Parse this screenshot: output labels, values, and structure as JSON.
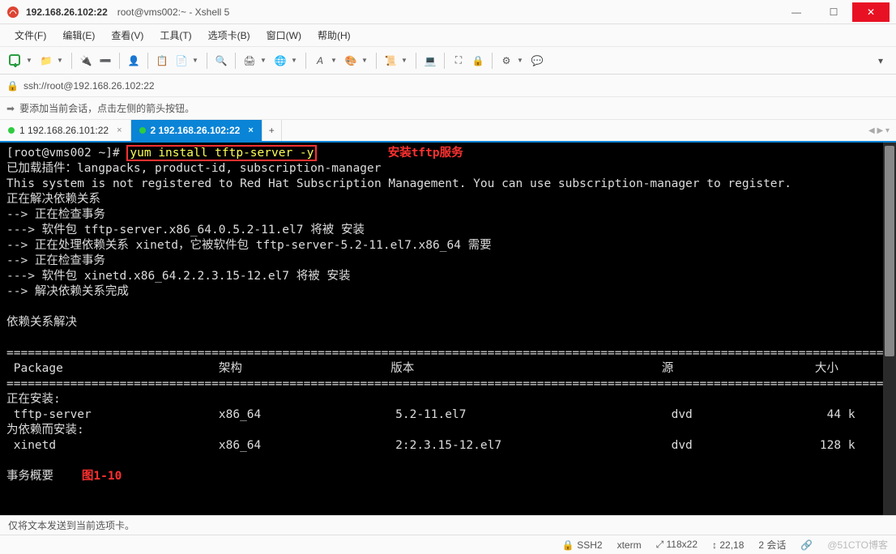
{
  "titlebar": {
    "address": "192.168.26.102:22",
    "title": "root@vms002:~ - Xshell 5"
  },
  "menu": {
    "file": "文件(F)",
    "edit": "编辑(E)",
    "view": "查看(V)",
    "tools": "工具(T)",
    "tabs": "选项卡(B)",
    "window": "窗口(W)",
    "help": "帮助(H)"
  },
  "addressbar": {
    "url": "ssh://root@192.168.26.102:22"
  },
  "infobar": {
    "text": "要添加当前会话，点击左侧的箭头按钮。"
  },
  "tabs": {
    "t1": "1 192.168.26.101:22",
    "t2": "2 192.168.26.102:22",
    "new": "+"
  },
  "terminal": {
    "prompt": "[root@vms002 ~]# ",
    "cmd": "yum install tftp-server -y",
    "annot1": "安装tftp服务",
    "l1": "已加载插件：langpacks, product-id, subscription-manager",
    "l2": "This system is not registered to Red Hat Subscription Management. You can use subscription-manager to register.",
    "l3": "正在解决依赖关系",
    "l4": "--> 正在检查事务",
    "l5": "---> 软件包 tftp-server.x86_64.0.5.2-11.el7 将被 安装",
    "l6": "--> 正在处理依赖关系 xinetd，它被软件包 tftp-server-5.2-11.el7.x86_64 需要",
    "l7": "--> 正在检查事务",
    "l8": "---> 软件包 xinetd.x86_64.2.2.3.15-12.el7 将被 安装",
    "l9": "--> 解决依赖关系完成",
    "l10": "依赖关系解决",
    "hdr": " Package                      架构                     版本                                   源                    大小",
    "sec1": "正在安装:",
    "r1": " tftp-server                  x86_64                   5.2-11.el7                             dvd                   44 k",
    "sec2": "为依赖而安装:",
    "r2": " xinetd                       x86_64                   2:2.3.15-12.el7                        dvd                  128 k",
    "l11": "事务概要",
    "annot2": "图1-10"
  },
  "footbar": {
    "text": "仅将文本发送到当前选项卡。"
  },
  "status": {
    "proto": "SSH2",
    "term": "xterm",
    "size": "118x22",
    "pos": "22,18",
    "sess": "2 会话",
    "wm": "@51CTO博客"
  },
  "icons": {
    "lock": "🔒",
    "arrow": "➡",
    "resize": "⤢",
    "link": "🔗",
    "updown": "↕"
  }
}
